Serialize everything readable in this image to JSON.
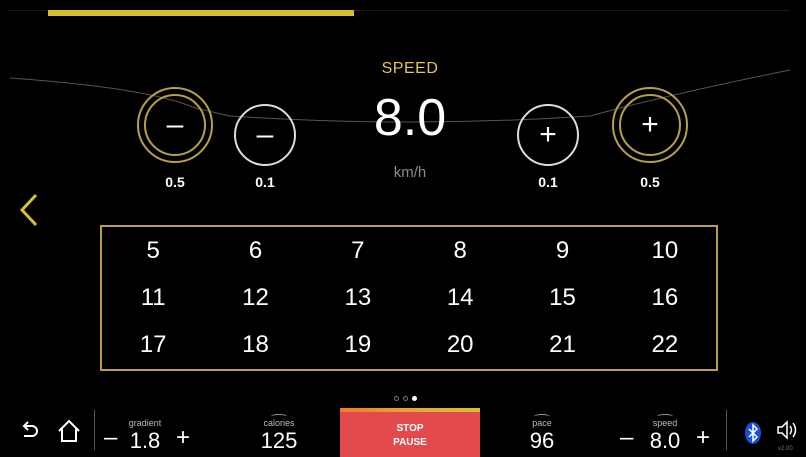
{
  "speed": {
    "title": "SPEED",
    "value": "8.0",
    "unit": "km/h"
  },
  "steps": {
    "minus_large_label": "0.5",
    "minus_small_label": "0.1",
    "plus_small_label": "0.1",
    "plus_large_label": "0.5",
    "minus_symbol": "–",
    "plus_symbol": "+"
  },
  "presets": [
    [
      "5",
      "6",
      "7",
      "8",
      "9",
      "10"
    ],
    [
      "11",
      "12",
      "13",
      "14",
      "15",
      "16"
    ],
    [
      "17",
      "18",
      "19",
      "20",
      "21",
      "22"
    ]
  ],
  "pager": {
    "pages": 3,
    "current": 3
  },
  "bottom": {
    "gradient": {
      "label": "gradient",
      "value": "1.8",
      "minus": "–",
      "plus": "+"
    },
    "calories": {
      "label": "calories",
      "value": "125"
    },
    "stop": {
      "line1": "STOP",
      "line2": "PAUSE"
    },
    "pace": {
      "label": "pace",
      "value": "96"
    },
    "speed": {
      "label": "speed",
      "value": "8.0",
      "minus": "–",
      "plus": "+"
    },
    "version": "v2.00"
  },
  "colors": {
    "accent": "#d8bf32",
    "ring": "#b6a04b",
    "stop": "#e34a4e",
    "background": "#000000"
  },
  "icons": [
    "chevron-left-icon",
    "undo-icon",
    "home-icon",
    "bluetooth-icon",
    "volume-icon"
  ]
}
